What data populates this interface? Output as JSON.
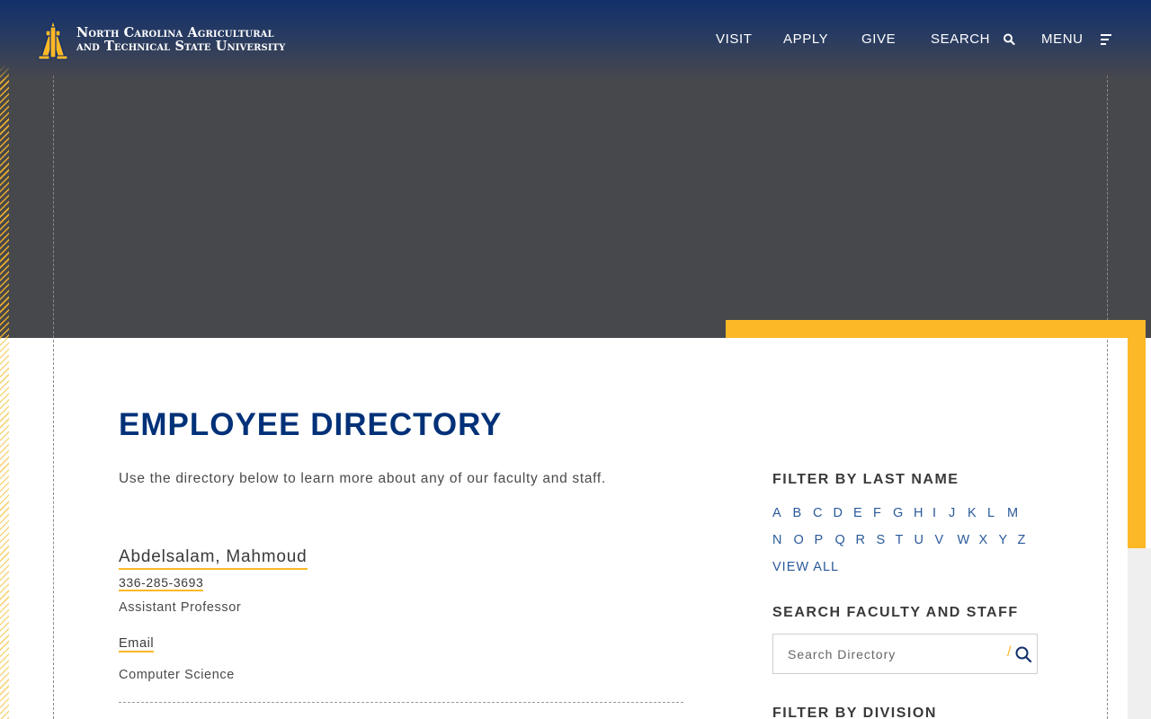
{
  "header": {
    "logo_line1": "North Carolina Agricultural",
    "logo_line2": "and Technical State University",
    "nav": {
      "visit": "VISIT",
      "apply": "APPLY",
      "give": "GIVE",
      "search": "SEARCH",
      "menu": "MENU"
    },
    "icons": {
      "search": "search-icon",
      "menu": "menu-icon"
    }
  },
  "colors": {
    "navy": "#003178",
    "gold": "#fdb827",
    "hero_gray": "#47484c",
    "link_blue": "#2a5a9a"
  },
  "main": {
    "title": "EMPLOYEE DIRECTORY",
    "intro": "Use the directory below to learn more about any of our faculty and staff.",
    "employees": [
      {
        "name": "Abdelsalam, Mahmoud",
        "phone": "336-285-3693",
        "title": "Assistant Professor",
        "email_label": "Email",
        "department": "Computer Science"
      }
    ]
  },
  "sidebar": {
    "filter_last_name": {
      "heading": "FILTER BY LAST NAME",
      "row1": [
        "A",
        "B",
        "C",
        "D",
        "E",
        "F",
        "G",
        "H",
        "I",
        "J",
        "K",
        "L",
        "M"
      ],
      "row2": [
        "N",
        "O",
        "P",
        "Q",
        "R",
        "S",
        "T",
        "U",
        "V",
        "W",
        "X",
        "Y",
        "Z"
      ],
      "view_all": "VIEW ALL"
    },
    "search": {
      "heading": "SEARCH FACULTY AND STAFF",
      "placeholder": "Search Directory",
      "slash": "/"
    },
    "filter_division": {
      "heading": "FILTER BY DIVISION"
    }
  }
}
